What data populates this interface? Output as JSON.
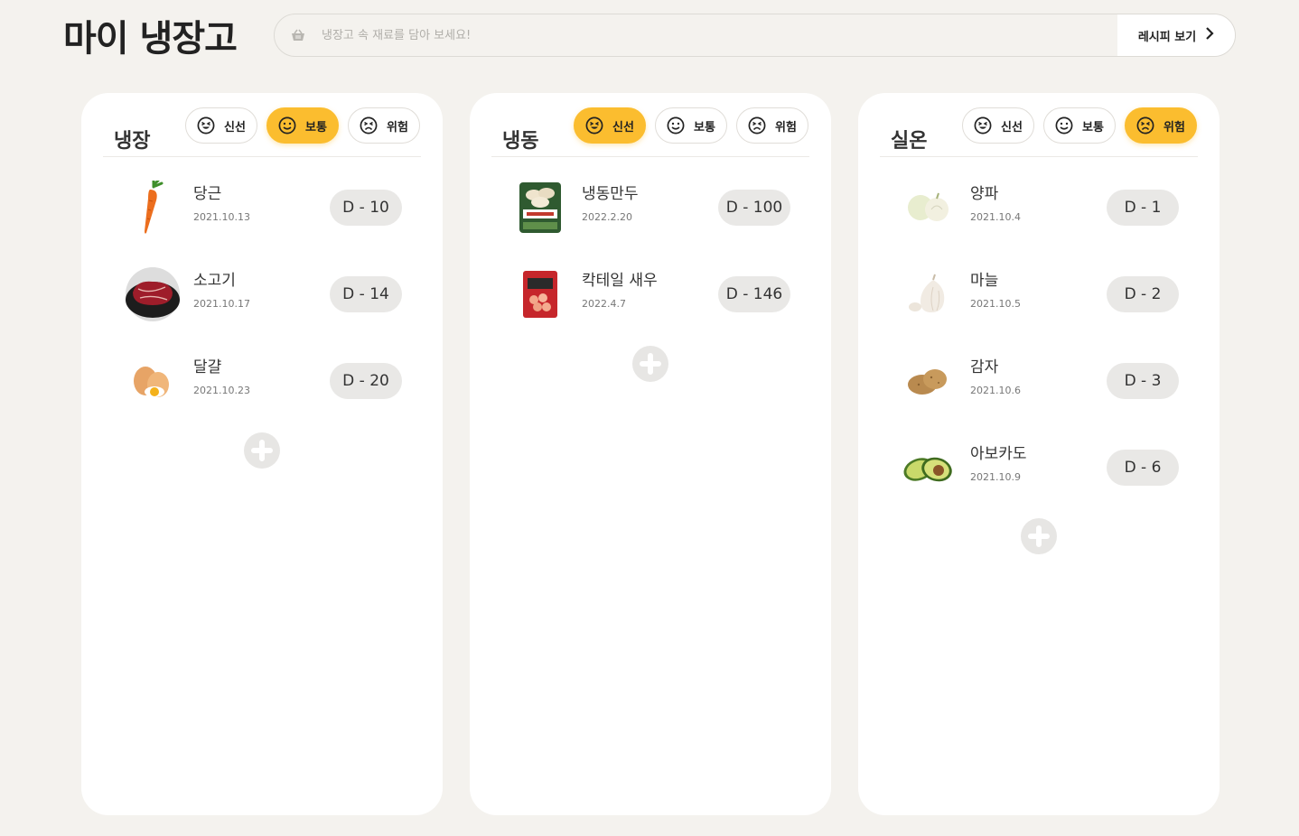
{
  "app": {
    "title": "마이 냉장고"
  },
  "search": {
    "placeholder": "냉장고 속 재료를 담아 보세요!",
    "value": "",
    "icon": "basket-icon"
  },
  "recipe_button": {
    "label": "레시피 보기",
    "icon": "chevron-right-icon"
  },
  "filters": {
    "fresh": "신선",
    "normal": "보통",
    "danger": "위험"
  },
  "colors": {
    "accent": "#fbbd2f",
    "background": "#f4f2ee",
    "panel": "#ffffff",
    "pill": "#e9e8e6"
  },
  "panels": [
    {
      "title": "냉장",
      "active_filter": "normal",
      "items": [
        {
          "name": "당근",
          "date": "2021.10.13",
          "dday": "D - 10",
          "icon": "carrot-icon"
        },
        {
          "name": "소고기",
          "date": "2021.10.17",
          "dday": "D - 14",
          "icon": "beef-icon"
        },
        {
          "name": "달걀",
          "date": "2021.10.23",
          "dday": "D - 20",
          "icon": "egg-icon"
        }
      ]
    },
    {
      "title": "냉동",
      "active_filter": "fresh",
      "items": [
        {
          "name": "냉동만두",
          "date": "2022.2.20",
          "dday": "D - 100",
          "icon": "dumpling-package-icon"
        },
        {
          "name": "칵테일 새우",
          "date": "2022.4.7",
          "dday": "D - 146",
          "icon": "shrimp-package-icon"
        }
      ]
    },
    {
      "title": "실온",
      "active_filter": "danger",
      "items": [
        {
          "name": "양파",
          "date": "2021.10.4",
          "dday": "D - 1",
          "icon": "onion-icon"
        },
        {
          "name": "마늘",
          "date": "2021.10.5",
          "dday": "D - 2",
          "icon": "garlic-icon"
        },
        {
          "name": "감자",
          "date": "2021.10.6",
          "dday": "D - 3",
          "icon": "potato-icon"
        },
        {
          "name": "아보카도",
          "date": "2021.10.9",
          "dday": "D - 6",
          "icon": "avocado-icon"
        }
      ]
    }
  ]
}
